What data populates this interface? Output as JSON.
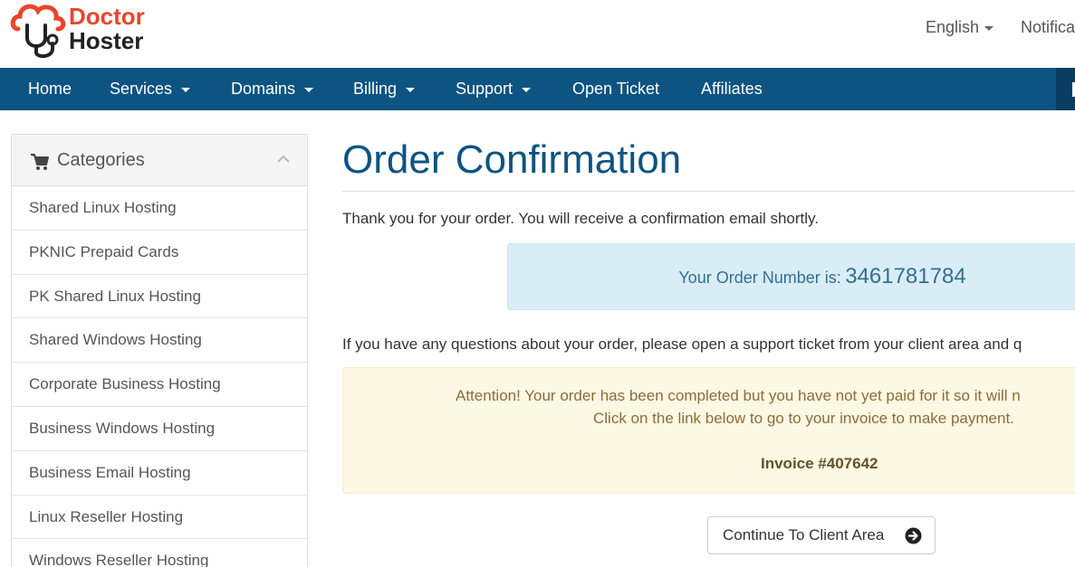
{
  "brand": {
    "line1": "Doctor",
    "line2": "Hoster"
  },
  "header": {
    "language": "English",
    "notifications": "Notifications"
  },
  "nav": {
    "items": [
      {
        "label": "Home"
      },
      {
        "label": "Services"
      },
      {
        "label": "Domains"
      },
      {
        "label": "Billing"
      },
      {
        "label": "Support"
      },
      {
        "label": "Open Ticket"
      },
      {
        "label": "Affiliates"
      }
    ]
  },
  "sidebar": {
    "title": "Categories",
    "items": [
      {
        "label": "Shared Linux Hosting"
      },
      {
        "label": "PKNIC Prepaid Cards"
      },
      {
        "label": "PK Shared Linux Hosting"
      },
      {
        "label": "Shared Windows Hosting"
      },
      {
        "label": "Corporate Business Hosting"
      },
      {
        "label": "Business Windows Hosting"
      },
      {
        "label": "Business Email Hosting"
      },
      {
        "label": "Linux Reseller Hosting"
      },
      {
        "label": "Windows Reseller Hosting"
      }
    ]
  },
  "main": {
    "title": "Order Confirmation",
    "thanks": "Thank you for your order. You will receive a confirmation email shortly.",
    "order_label": "Your Order Number is:",
    "order_number": "3461781784",
    "questions": "If you have any questions about your order, please open a support ticket from your client area and q",
    "warning_line1": "Attention! Your order has been completed but you have not yet paid for it so it will n",
    "warning_line2": "Click on the link below to go to your invoice to make payment.",
    "invoice_link": "Invoice #407642",
    "continue_label": "Continue To Client Area"
  },
  "colors": {
    "brand_red": "#e8452c",
    "nav_blue": "#0d5482",
    "info_bg": "#d9edf7",
    "warning_bg": "#fcf8e3"
  }
}
